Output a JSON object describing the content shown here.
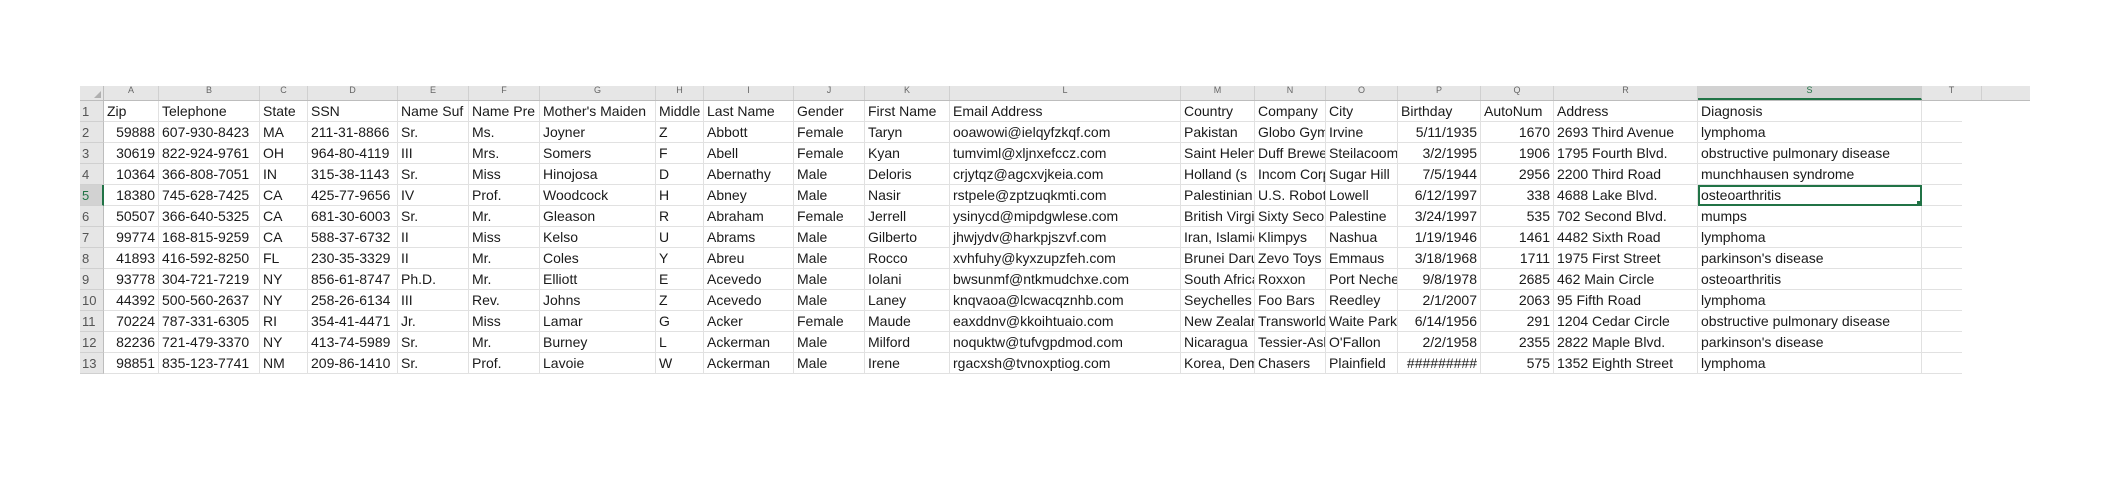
{
  "sheet": {
    "column_letters": [
      "A",
      "B",
      "C",
      "D",
      "E",
      "F",
      "G",
      "H",
      "I",
      "J",
      "K",
      "L",
      "M",
      "N",
      "O",
      "P",
      "Q",
      "R",
      "S"
    ],
    "extra_column_letter": "T",
    "selected_column": "S",
    "selected_row": "5",
    "headers": [
      "Zip",
      "Telephone",
      "State",
      "SSN",
      "Name Suf",
      "Name Pre",
      "Mother's Maiden",
      "Middle",
      "Last Name",
      "Gender",
      "First Name",
      "Email Address",
      "Country",
      "Company",
      "City",
      "Birthday",
      "AutoNum",
      "Address",
      "Diagnosis"
    ],
    "rows": [
      {
        "num": "2",
        "cells": [
          "59888",
          "607-930-8423",
          "MA",
          "211-31-8866",
          "Sr.",
          "Ms.",
          "Joyner",
          "Z",
          "Abbott",
          "Female",
          "Taryn",
          "ooawowi@ielqyfzkqf.com",
          "Pakistan",
          "Globo Gym",
          "Irvine",
          "5/11/1935",
          "1670",
          "2693 Third Avenue",
          "lymphoma"
        ]
      },
      {
        "num": "3",
        "cells": [
          "30619",
          "822-924-9761",
          "OH",
          "964-80-4119",
          "III",
          "Mrs.",
          "Somers",
          "F",
          "Abell",
          "Female",
          "Kyan",
          "tumviml@xljnxefccz.com",
          "Saint Helena",
          "Duff Brewery",
          "Steilacoom",
          "3/2/1995",
          "1906",
          "1795 Fourth Blvd.",
          "obstructive pulmonary disease"
        ]
      },
      {
        "num": "4",
        "cells": [
          "10364",
          "366-808-7051",
          "IN",
          "315-38-1143",
          "Sr.",
          "Miss",
          "Hinojosa",
          "D",
          "Abernathy",
          "Male",
          "Deloris",
          "crjytqz@agcxvjkeia.com",
          "Holland (s",
          "Incom Corp",
          "Sugar Hill",
          "7/5/1944",
          "2956",
          "2200 Third Road",
          "munchhausen syndrome"
        ]
      },
      {
        "num": "5",
        "cells": [
          "18380",
          "745-628-7425",
          "CA",
          "425-77-9656",
          "IV",
          "Prof.",
          "Woodcock",
          "H",
          "Abney",
          "Male",
          "Nasir",
          "rstpele@zptzuqkmti.com",
          "Palestinian",
          "U.S. Robotics",
          "Lowell",
          "6/12/1997",
          "338",
          "4688 Lake Blvd.",
          "osteoarthritis"
        ]
      },
      {
        "num": "6",
        "cells": [
          "50507",
          "366-640-5325",
          "CA",
          "681-30-6003",
          "Sr.",
          "Mr.",
          "Gleason",
          "R",
          "Abraham",
          "Female",
          "Jerrell",
          "ysinycd@mipdgwlese.com",
          "British Virgin",
          "Sixty Second",
          "Palestine",
          "3/24/1997",
          "535",
          "702 Second Blvd.",
          "mumps"
        ]
      },
      {
        "num": "7",
        "cells": [
          "99774",
          "168-815-9259",
          "CA",
          "588-37-6732",
          "II",
          "Miss",
          "Kelso",
          "U",
          "Abrams",
          "Male",
          "Gilberto",
          "jhwjydv@harkpjszvf.com",
          "Iran, Islamic",
          "Klimpys",
          "Nashua",
          "1/19/1946",
          "1461",
          "4482 Sixth Road",
          "lymphoma"
        ]
      },
      {
        "num": "8",
        "cells": [
          "41893",
          "416-592-8250",
          "FL",
          "230-35-3329",
          "II",
          "Mr.",
          "Coles",
          "Y",
          "Abreu",
          "Male",
          "Rocco",
          "xvhfuhy@kyxzupzfeh.com",
          "Brunei Darussalam",
          "Zevo Toys",
          "Emmaus",
          "3/18/1968",
          "1711",
          "1975 First Street",
          "parkinson's disease"
        ]
      },
      {
        "num": "9",
        "cells": [
          "93778",
          "304-721-7219",
          "NY",
          "856-61-8747",
          "Ph.D.",
          "Mr.",
          "Elliott",
          "E",
          "Acevedo",
          "Male",
          "Iolani",
          "bwsunmf@ntkmudchxe.com",
          "South Africa",
          "Roxxon",
          "Port Neches",
          "9/8/1978",
          "2685",
          "462 Main Circle",
          "osteoarthritis"
        ]
      },
      {
        "num": "10",
        "cells": [
          "44392",
          "500-560-2637",
          "NY",
          "258-26-6134",
          "III",
          "Rev.",
          "Johns",
          "Z",
          "Acevedo",
          "Male",
          "Laney",
          "knqvaoa@lcwacqznhb.com",
          "Seychelles",
          "Foo Bars",
          "Reedley",
          "2/1/2007",
          "2063",
          "95 Fifth Road",
          "lymphoma"
        ]
      },
      {
        "num": "11",
        "cells": [
          "70224",
          "787-331-6305",
          "RI",
          "354-41-4471",
          "Jr.",
          "Miss",
          "Lamar",
          "G",
          "Acker",
          "Female",
          "Maude",
          "eaxddnv@kkoihtuaio.com",
          "New Zealand",
          "Transworld",
          "Waite Park",
          "6/14/1956",
          "291",
          "1204 Cedar Circle",
          "obstructive pulmonary disease"
        ]
      },
      {
        "num": "12",
        "cells": [
          "82236",
          "721-479-3370",
          "NY",
          "413-74-5989",
          "Sr.",
          "Mr.",
          "Burney",
          "L",
          "Ackerman",
          "Male",
          "Milford",
          "noquktw@tufvgpdmod.com",
          "Nicaragua",
          "Tessier-Ashpool",
          "O'Fallon",
          "2/2/1958",
          "2355",
          "2822 Maple Blvd.",
          "parkinson's disease"
        ]
      },
      {
        "num": "13",
        "cells": [
          "98851",
          "835-123-7741",
          "NM",
          "209-86-1410",
          "Sr.",
          "Prof.",
          "Lavoie",
          "W",
          "Ackerman",
          "Male",
          "Irene",
          "rgacxsh@tvnoxptiog.com",
          "Korea, Democratic",
          "Chasers",
          "Plainfield",
          "#########",
          "575",
          "1352 Eighth Street",
          "lymphoma"
        ]
      }
    ],
    "header_row_number": "1",
    "colors": {
      "accent": "#217346",
      "header_bg": "#e6e6e6",
      "grid": "#e1e1e1"
    }
  }
}
